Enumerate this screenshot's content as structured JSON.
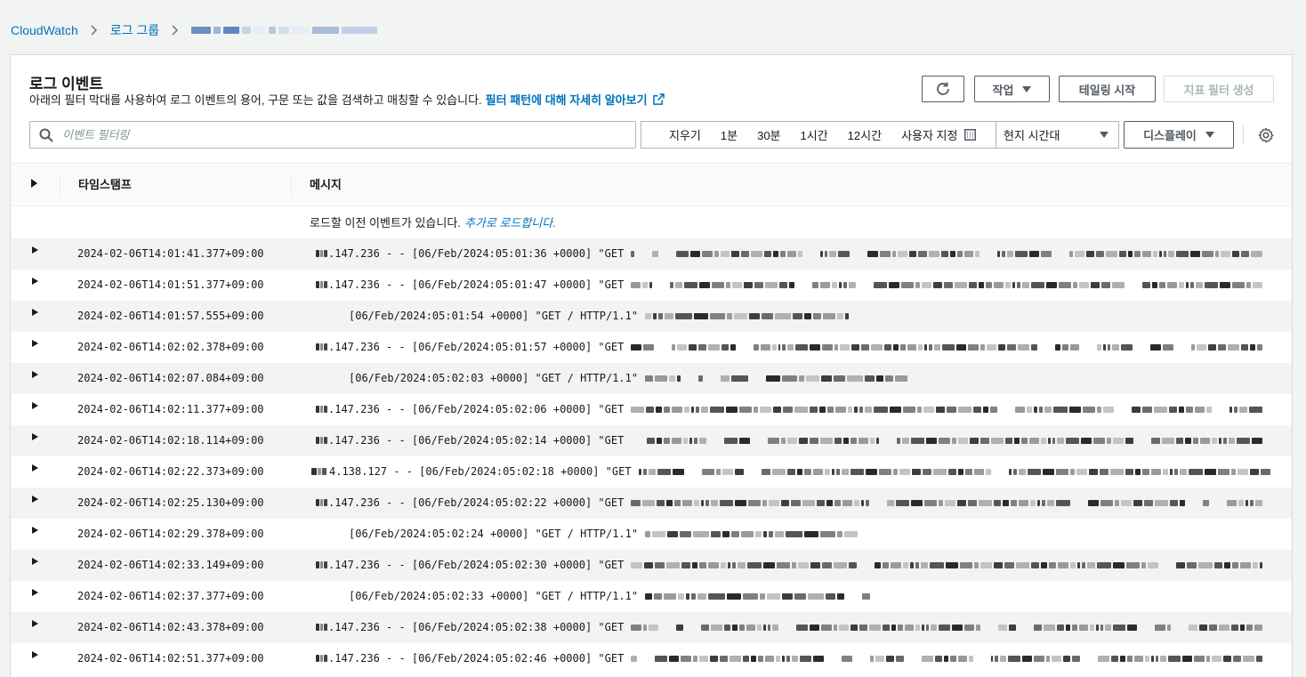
{
  "breadcrumb": {
    "root": "CloudWatch",
    "group": "로그 그룹"
  },
  "panel": {
    "title": "로그 이벤트",
    "description": "아래의 필터 막대를 사용하여 로그 이벤트의 용어, 구문 또는 값을 검색하고 매칭할 수 있습니다.",
    "learn_more": "필터 패턴에 대해 자세히 알아보기"
  },
  "toolbar": {
    "refresh_icon": "refresh-icon",
    "actions_label": "작업",
    "tail_label": "테일링 시작",
    "metric_filter_label": "지표 필터 생성",
    "display_label": "디스플레이"
  },
  "search": {
    "placeholder": "이벤트 필터링"
  },
  "range": {
    "items": [
      "지우기",
      "1분",
      "30분",
      "1시간",
      "12시간",
      "사용자 지정"
    ]
  },
  "timezone": {
    "value": "현지 시간대"
  },
  "table": {
    "col_timestamp": "타임스탬프",
    "col_message": "메시지",
    "load_text": "로드할 이전 이벤트가 있습니다.",
    "load_more": "추가로 로드합니다."
  },
  "rows": [
    {
      "ts": "2024-02-06T14:01:41.377+09:00",
      "msg": ".147.236 - - [06/Feb/2024:05:01:36 +0000] \"GET",
      "kind": "a"
    },
    {
      "ts": "2024-02-06T14:01:51.377+09:00",
      "msg": ".147.236 - - [06/Feb/2024:05:01:47 +0000] \"GET",
      "kind": "a"
    },
    {
      "ts": "2024-02-06T14:01:57.555+09:00",
      "msg": "[06/Feb/2024:05:01:54 +0000] \"GET / HTTP/1.1\"",
      "kind": "b"
    },
    {
      "ts": "2024-02-06T14:02:02.378+09:00",
      "msg": ".147.236 - - [06/Feb/2024:05:01:57 +0000] \"GET",
      "kind": "a"
    },
    {
      "ts": "2024-02-06T14:02:07.084+09:00",
      "msg": "[06/Feb/2024:05:02:03 +0000] \"GET / HTTP/1.1\"",
      "kind": "b"
    },
    {
      "ts": "2024-02-06T14:02:11.377+09:00",
      "msg": ".147.236 - - [06/Feb/2024:05:02:06 +0000] \"GET",
      "kind": "a"
    },
    {
      "ts": "2024-02-06T14:02:18.114+09:00",
      "msg": ".147.236 - - [06/Feb/2024:05:02:14 +0000] \"GET",
      "kind": "a"
    },
    {
      "ts": "2024-02-06T14:02:22.373+09:00",
      "msg": "4.138.127 - - [06/Feb/2024:05:02:18 +0000] \"GET",
      "kind": "c"
    },
    {
      "ts": "2024-02-06T14:02:25.130+09:00",
      "msg": ".147.236 - - [06/Feb/2024:05:02:22 +0000] \"GET",
      "kind": "a"
    },
    {
      "ts": "2024-02-06T14:02:29.378+09:00",
      "msg": "[06/Feb/2024:05:02:24 +0000] \"GET / HTTP/1.1\"",
      "kind": "b"
    },
    {
      "ts": "2024-02-06T14:02:33.149+09:00",
      "msg": ".147.236 - - [06/Feb/2024:05:02:30 +0000] \"GET",
      "kind": "a"
    },
    {
      "ts": "2024-02-06T14:02:37.377+09:00",
      "msg": "[06/Feb/2024:05:02:33 +0000] \"GET / HTTP/1.1\"",
      "kind": "b"
    },
    {
      "ts": "2024-02-06T14:02:43.378+09:00",
      "msg": ".147.236 - - [06/Feb/2024:05:02:38 +0000] \"GET",
      "kind": "a"
    },
    {
      "ts": "2024-02-06T14:02:51.377+09:00",
      "msg": ".147.236 - - [06/Feb/2024:05:02:46 +0000] \"GET",
      "kind": "a"
    }
  ],
  "colors": {
    "link": "#0073bb",
    "row_alt": "#f2f3f3",
    "border": "#aab7b8"
  }
}
